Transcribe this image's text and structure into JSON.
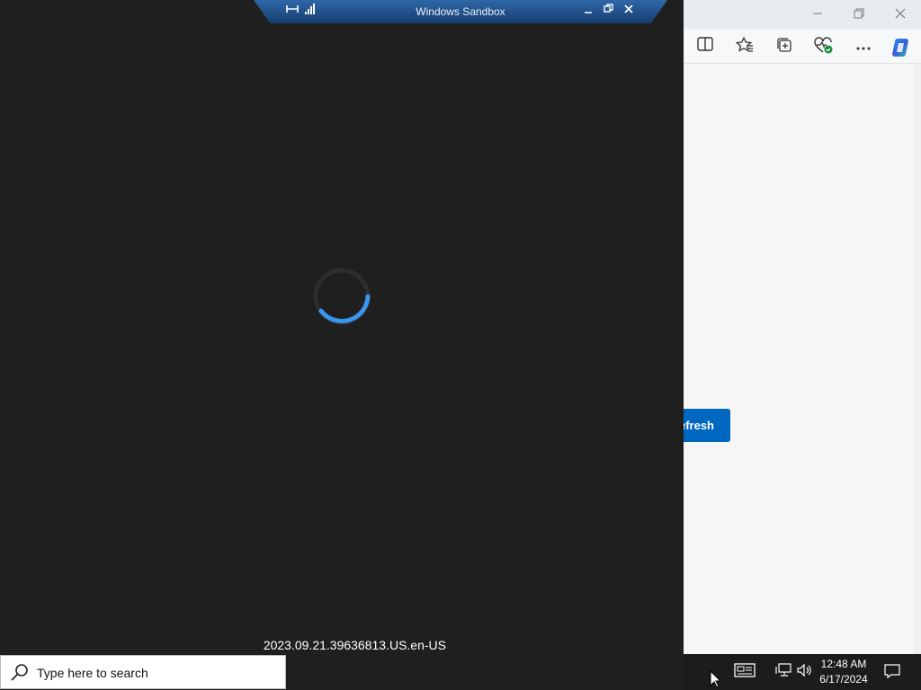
{
  "sandbox": {
    "title": "Windows Sandbox",
    "build_text": "2023.09.21.39636813.US.en-US"
  },
  "taskbar": {
    "search_placeholder": "Type here to search",
    "time": "12:48 AM",
    "date": "6/17/2024"
  },
  "edge": {
    "refresh_label": "Refresh",
    "toolbar_icons": [
      "split-screen-icon",
      "favorites-icon",
      "collections-icon",
      "browser-essentials-icon",
      "more-options-icon",
      "copilot-icon"
    ]
  },
  "colors": {
    "sandbox_bg": "#1f1f1f",
    "accent_blue": "#0067c0",
    "spinner_blue": "#3a96ee"
  }
}
